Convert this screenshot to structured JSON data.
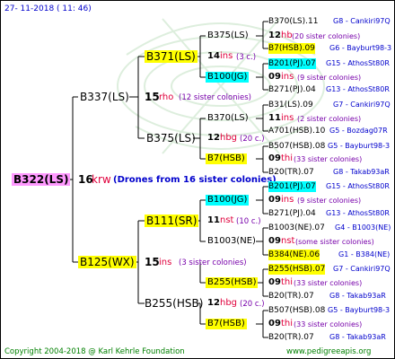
{
  "header": {
    "date": "27- 11-2018 ( 11: 46)"
  },
  "footer": {
    "copyright": "Copyright 2004-2018 @ Karl Kehrle Foundation",
    "website": "www.pedigreeapis.org"
  },
  "root": {
    "id": "B322(LS)",
    "gen_no": "16",
    "code": "krw",
    "note": "(Drones from 16 sister colonies)"
  },
  "sire": {
    "id": "B337(LS)",
    "gen_no": "15",
    "code": "rho",
    "note": "(12 sister colonies)",
    "sire": {
      "id": "B371(LS)",
      "gen_no": "14",
      "code": "ins",
      "note": "(3 c.)",
      "sire": {
        "id": "B375(LS)",
        "gen_no": "12",
        "code": "hb",
        "note": "(20 sister colonies)",
        "sire": {
          "id": "B370(LS).11",
          "origin": "G8 - Cankiri97Q"
        },
        "dam": {
          "id": "B7(HSB).09",
          "origin": "G6 - Bayburt98-3"
        }
      },
      "dam": {
        "id": "B100(JG)",
        "gen_no": "09",
        "code": "ins",
        "note": "(9 sister colonies)",
        "sire": {
          "id": "B201(PJ).07",
          "origin": "G15 - AthosSt80R"
        },
        "dam": {
          "id": "B271(PJ).04",
          "origin": "G13 - AthosSt80R"
        }
      }
    },
    "dam": {
      "id": "B375(LS)",
      "gen_no": "12",
      "code": "hbg",
      "note": "(20 c.)",
      "sire": {
        "id": "B370(LS)",
        "gen_no": "11",
        "code": "ins",
        "note": "(2 sister colonies)",
        "sire": {
          "id": "B31(LS).09",
          "origin": "G7 - Cankiri97Q"
        },
        "dam": {
          "id": "A701(HSB).10",
          "origin": "G5 - Bozdag07R"
        }
      },
      "dam": {
        "id": "B7(HSB)",
        "gen_no": "09",
        "code": "thi",
        "note": "(33 sister colonies)",
        "sire": {
          "id": "B507(HSB).08",
          "origin": "G5 - Bayburt98-3"
        },
        "dam": {
          "id": "B20(TR).07",
          "origin": "G8 - Takab93aR"
        }
      }
    }
  },
  "dam": {
    "id": "B125(WX)",
    "gen_no": "15",
    "code": "ins",
    "note": "(3 sister colonies)",
    "sire": {
      "id": "B111(SR)",
      "gen_no": "11",
      "code": "nst",
      "note": "(10 c.)",
      "sire": {
        "id": "B100(JG)",
        "gen_no": "09",
        "code": "ins",
        "note": "(9 sister colonies)",
        "sire": {
          "id": "B201(PJ).07",
          "origin": "G15 - AthosSt80R"
        },
        "dam": {
          "id": "B271(PJ).04",
          "origin": "G13 - AthosSt80R"
        }
      },
      "dam": {
        "id": "B1003(NE)",
        "gen_no": "09",
        "code": "nst",
        "note": "(some sister colonies)",
        "sire": {
          "id": "B1003(NE).07",
          "origin": "G4 - B1003(NE)"
        },
        "dam": {
          "id": "B384(NE).06",
          "origin": "G1 - B384(NE)"
        }
      }
    },
    "dam": {
      "id": "B255(HSB)",
      "gen_no": "12",
      "code": "hbg",
      "note": "(20 c.)",
      "sire": {
        "id": "B255(HSB)",
        "gen_no": "09",
        "code": "thi",
        "note": "(33 sister colonies)",
        "sire": {
          "id": "B255(HSB).07",
          "origin": "G7 - Cankiri97Q"
        },
        "dam": {
          "id": "B20(TR).07",
          "origin": "G8 - Takab93aR"
        }
      },
      "dam": {
        "id": "B7(HSB)",
        "gen_no": "09",
        "code": "thi",
        "note": "(33 sister colonies)",
        "sire": {
          "id": "B507(HSB).08",
          "origin": "G5 - Bayburt98-3"
        },
        "dam": {
          "id": "B20(TR).07",
          "origin": "G8 - Takab93aR"
        }
      }
    }
  }
}
